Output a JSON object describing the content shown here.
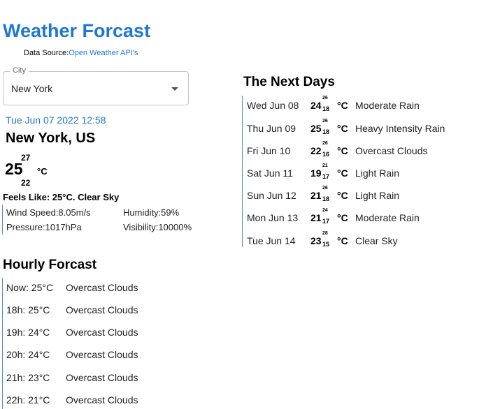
{
  "header": {
    "title": "Weather Forcast",
    "data_source_prefix": "Data Source:",
    "data_source_link": "Open Weather API's"
  },
  "city_select": {
    "label": "City",
    "value": "New York"
  },
  "current": {
    "datetime": "Tue Jun 07 2022 12:58",
    "location": "New York, US",
    "temp": "25",
    "temp_high": "27",
    "temp_low": "22",
    "unit": "°C",
    "feels_like": "Feels Like: 25°C. Clear Sky",
    "wind_speed": "Wind Speed:8.05m/s",
    "humidity": "Humidity:59%",
    "pressure": "Pressure:1017hPa",
    "visibility": "Visibility:10000%"
  },
  "next_days": {
    "title": "The Next Days",
    "days": [
      {
        "date": "Wed Jun 08",
        "temp": "24",
        "high": "26",
        "low": "18",
        "unit": "°C",
        "condition": "Moderate Rain"
      },
      {
        "date": "Thu Jun 09",
        "temp": "25",
        "high": "26",
        "low": "18",
        "unit": "°C",
        "condition": "Heavy Intensity Rain"
      },
      {
        "date": "Fri Jun 10",
        "temp": "22",
        "high": "26",
        "low": "16",
        "unit": "°C",
        "condition": "Overcast Clouds"
      },
      {
        "date": "Sat Jun 11",
        "temp": "19",
        "high": "21",
        "low": "17",
        "unit": "°C",
        "condition": "Light Rain"
      },
      {
        "date": "Sun Jun 12",
        "temp": "21",
        "high": "26",
        "low": "18",
        "unit": "°C",
        "condition": "Light Rain"
      },
      {
        "date": "Mon Jun 13",
        "temp": "21",
        "high": "24",
        "low": "17",
        "unit": "°C",
        "condition": "Moderate Rain"
      },
      {
        "date": "Tue Jun 14",
        "temp": "23",
        "high": "28",
        "low": "15",
        "unit": "°C",
        "condition": "Clear Sky"
      }
    ]
  },
  "hourly": {
    "title": "Hourly Forcast",
    "hours": [
      {
        "time": "Now: 25°C",
        "condition": "Overcast Clouds"
      },
      {
        "time": "18h: 25°C",
        "condition": "Overcast Clouds"
      },
      {
        "time": "19h: 24°C",
        "condition": "Overcast Clouds"
      },
      {
        "time": "20h: 24°C",
        "condition": "Overcast Clouds"
      },
      {
        "time": "21h: 23°C",
        "condition": "Overcast Clouds"
      },
      {
        "time": "22h: 21°C",
        "condition": "Overcast Clouds"
      }
    ]
  }
}
